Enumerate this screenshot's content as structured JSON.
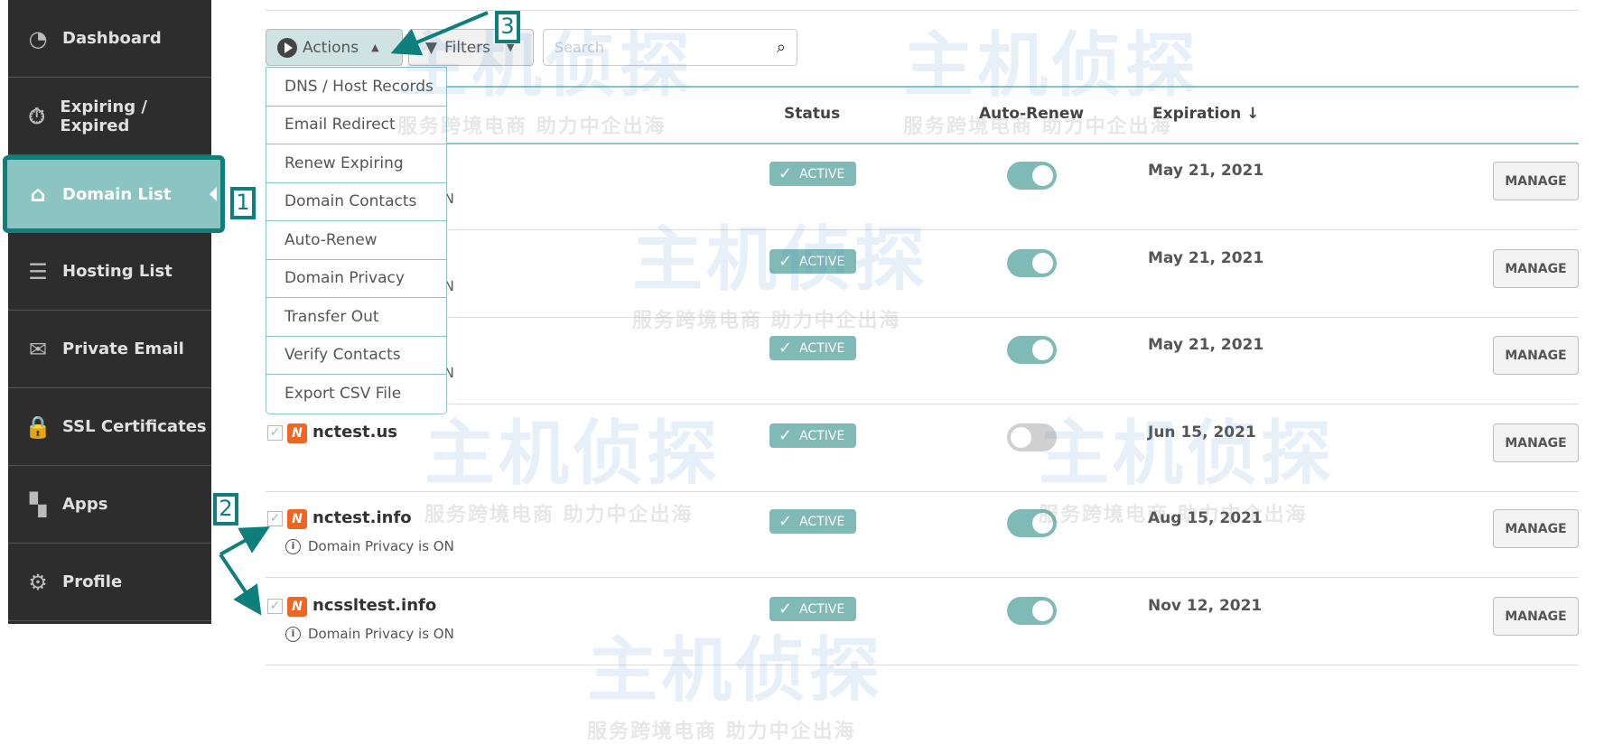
{
  "sidebar": {
    "items": [
      {
        "label": "Dashboard",
        "icon": "gauge-icon"
      },
      {
        "label": "Expiring / Expired",
        "icon": "stopwatch-icon"
      },
      {
        "label": "Domain List",
        "icon": "home-icon",
        "active": true
      },
      {
        "label": "Hosting List",
        "icon": "server-icon"
      },
      {
        "label": "Private Email",
        "icon": "envelope-icon"
      },
      {
        "label": "SSL Certificates",
        "icon": "lock-icon"
      },
      {
        "label": "Apps",
        "icon": "apps-icon"
      },
      {
        "label": "Profile",
        "icon": "gear-icon"
      }
    ]
  },
  "toolbar": {
    "actions_label": "Actions",
    "filters_label": "Filters",
    "search_placeholder": "Search"
  },
  "actions_menu": [
    "DNS / Host Records",
    "Email Redirect",
    "Renew Expiring",
    "Domain Contacts",
    "Auto-Renew",
    "Domain Privacy",
    "Transfer Out",
    "Verify Contacts",
    "Export CSV File"
  ],
  "table": {
    "headers": {
      "status": "Status",
      "auto_renew": "Auto-Renew",
      "expiration": "Expiration ↓"
    },
    "rows": [
      {
        "domain": "",
        "privacy": "Domain Privacy is ON",
        "status": "ACTIVE",
        "auto_renew": true,
        "expiration": "May 21, 2021",
        "action": "MANAGE"
      },
      {
        "domain": "",
        "privacy": "Domain Privacy is ON",
        "status": "ACTIVE",
        "auto_renew": true,
        "expiration": "May 21, 2021",
        "action": "MANAGE"
      },
      {
        "domain": "",
        "privacy": "Domain Privacy is ON",
        "status": "ACTIVE",
        "auto_renew": true,
        "expiration": "May 21, 2021",
        "action": "MANAGE"
      },
      {
        "domain": "nctest.us",
        "privacy": "",
        "status": "ACTIVE",
        "auto_renew": false,
        "expiration": "Jun 15, 2021",
        "action": "MANAGE"
      },
      {
        "domain": "nctest.info",
        "privacy": "Domain Privacy is ON",
        "status": "ACTIVE",
        "auto_renew": true,
        "expiration": "Aug 15, 2021",
        "action": "MANAGE"
      },
      {
        "domain": "ncssltest.info",
        "privacy": "Domain Privacy is ON",
        "status": "ACTIVE",
        "auto_renew": true,
        "expiration": "Nov 12, 2021",
        "action": "MANAGE"
      }
    ]
  },
  "annotations": [
    "1",
    "2",
    "3"
  ],
  "watermark": {
    "title": "主机侦探",
    "slogan": "服务跨境电商 助力中企出海"
  },
  "colors": {
    "accent": "#8cc4c1",
    "annotation": "#0e7f7b",
    "sidebar": "#2d2d2d",
    "logo": "#f16522"
  }
}
